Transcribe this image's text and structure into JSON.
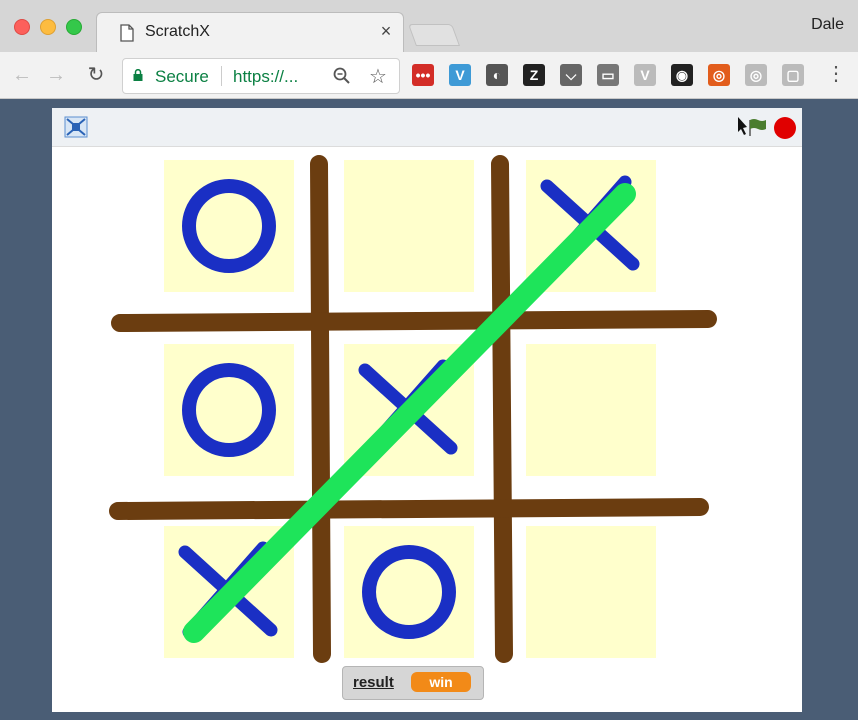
{
  "browser": {
    "tab_title": "ScratchX",
    "tab_close": "×",
    "profile_name": "Dale",
    "omnibox": {
      "secure_label": "Secure",
      "url_text": "https://...",
      "zoom_icon": "magnifier-icon",
      "star_icon": "bookmark-star-icon"
    },
    "nav": {
      "back": "←",
      "forward": "→",
      "reload": "↻"
    },
    "extensions": [
      {
        "name": "lastpass-extension",
        "glyph": "•••",
        "color": "#d32d27"
      },
      {
        "name": "vuejs-extension",
        "glyph": "V",
        "color": "#3e9ad6"
      },
      {
        "name": "evernote-extension",
        "glyph": "◐",
        "color": "#555555"
      },
      {
        "name": "zotero-extension",
        "glyph": "Z",
        "color": "#222222"
      },
      {
        "name": "pocket-extension",
        "glyph": "⌵",
        "color": "#666666"
      },
      {
        "name": "cast-extension",
        "glyph": "▭",
        "color": "#777777"
      },
      {
        "name": "vimium-extension",
        "glyph": "V",
        "color": "#bbbbbb"
      },
      {
        "name": "incognito-extension",
        "glyph": "◉",
        "color": "#222222"
      },
      {
        "name": "ubuntu-extension",
        "glyph": "◎",
        "color": "#e25d1c"
      },
      {
        "name": "grey-circle-extension",
        "glyph": "◎",
        "color": "#bbbbbb"
      },
      {
        "name": "window-extension",
        "glyph": "▢",
        "color": "#bbbbbb"
      }
    ],
    "menu_glyph": "⋮"
  },
  "stage": {
    "colors": {
      "cell": "#ffffcc",
      "grid": "#6b3d10",
      "mark": "#1a2fc4",
      "win_line": "#1ee45a"
    },
    "board": [
      [
        "O",
        "",
        "X"
      ],
      [
        "O",
        "X",
        ""
      ],
      [
        "X",
        "O",
        ""
      ]
    ],
    "win_line": "anti-diagonal",
    "reporter": {
      "label": "result",
      "value": "win"
    }
  }
}
